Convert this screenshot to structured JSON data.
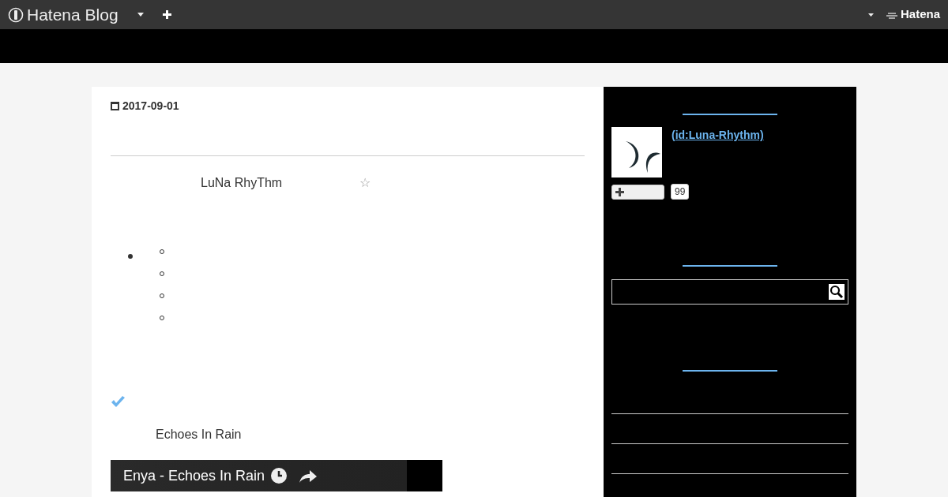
{
  "navbar": {
    "brand": "Hatena Blog",
    "right_brand": "Hatena"
  },
  "entry": {
    "date": "2017-09-01",
    "author": "LuNa RhyThm",
    "star": "☆",
    "section_title": "Echoes In Rain",
    "video": {
      "title": "Enya - Echoes In Rain"
    }
  },
  "sidebar": {
    "profile_link": "(id:Luna-Rhythm)",
    "subscribe_count": "99"
  }
}
